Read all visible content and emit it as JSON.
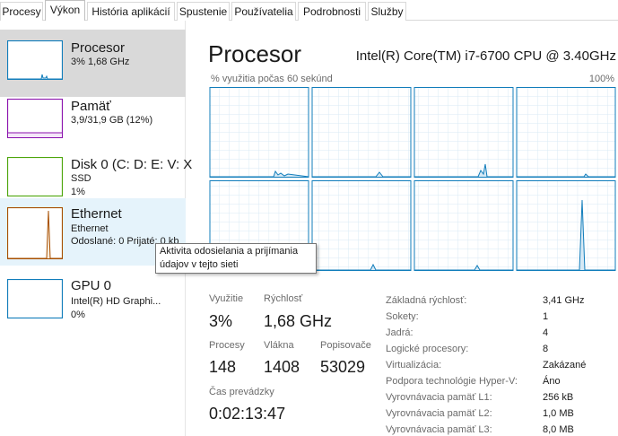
{
  "colors": {
    "cpu": "#117dbb",
    "memory": "#8b12ae",
    "disk": "#4da60c",
    "ethernet": "#a74f01",
    "gpu": "#117dbb",
    "grid": "#d9eaf4",
    "selected": "#d9d9d9",
    "hover": "#e5f3fb"
  },
  "tabs": [
    "Procesy",
    "Výkon",
    "História aplikácií",
    "Spustenie",
    "Používatelia",
    "Podrobnosti",
    "Služby"
  ],
  "active_tab": "Výkon",
  "sidebar": {
    "items": [
      {
        "title": "Procesor",
        "line1": "3% 1,68 GHz",
        "line2": "",
        "line3": "",
        "color_key": "cpu"
      },
      {
        "title": "Pamäť",
        "line1": "3,9/31,9 GB (12%)",
        "line2": "",
        "line3": "",
        "color_key": "memory"
      },
      {
        "title": "Disk 0 (C: D: E: V: X",
        "line1": "SSD",
        "line2": "1%",
        "line3": "",
        "color_key": "disk"
      },
      {
        "title": "Ethernet",
        "line1": "Ethernet",
        "line2": "Odoslané: 0 Prijaté: 0 kb",
        "line3": "",
        "color_key": "ethernet"
      },
      {
        "title": "GPU 0",
        "line1": "Intel(R) HD Graphi...",
        "line2": "0%",
        "line3": "",
        "color_key": "gpu"
      }
    ]
  },
  "tooltip": {
    "line1": "Aktivita odosielania a prijímania",
    "line2": "údajov v tejto sieti"
  },
  "header": {
    "title": "Procesor",
    "cpu_name": "Intel(R) Core(TM) i7-6700 CPU @ 3.40GHz"
  },
  "graph": {
    "axis_label": "% využitia počas 60 sekúnd",
    "axis_max": "100%"
  },
  "stats": {
    "usage_label": "Využitie",
    "usage_value": "3%",
    "speed_label": "Rýchlosť",
    "speed_value": "1,68 GHz",
    "processes_label": "Procesy",
    "processes_value": "148",
    "threads_label": "Vlákna",
    "threads_value": "1408",
    "handles_label": "Popisovače",
    "handles_value": "53029",
    "uptime_label": "Čas prevádzky",
    "uptime_value": "0:02:13:47"
  },
  "info": [
    {
      "label": "Základná rýchlosť:",
      "value": "3,41 GHz"
    },
    {
      "label": "Sokety:",
      "value": "1"
    },
    {
      "label": "Jadrá:",
      "value": "4"
    },
    {
      "label": "Logické procesory:",
      "value": "8"
    },
    {
      "label": "Virtualizácia:",
      "value": "Zakázané"
    },
    {
      "label": "Podpora technológie Hyper-V:",
      "value": "Áno"
    },
    {
      "label": "Vyrovnávacia pamäť L1:",
      "value": "256 kB"
    },
    {
      "label": "Vyrovnávacia pamäť L2:",
      "value": "1,0 MB"
    },
    {
      "label": "Vyrovnávacia pamäť L3:",
      "value": "8,0 MB"
    }
  ]
}
